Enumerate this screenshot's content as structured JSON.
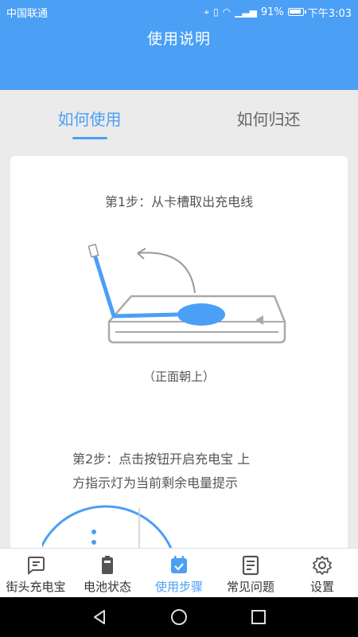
{
  "status": {
    "carrier": "中国联通",
    "battery": "91%",
    "time": "下午3:03"
  },
  "header": {
    "title": "使用说明"
  },
  "tabs": [
    {
      "label": "如何使用",
      "active": true
    },
    {
      "label": "如何归还",
      "active": false
    }
  ],
  "steps": {
    "step1": "第1步：从卡槽取出充电线",
    "step1_caption": "（正面朝上）",
    "step2_line1": "第2步：点击按钮开启充电宝 上",
    "step2_line2": "方指示灯为当前剩余电量提示"
  },
  "tabbar": [
    {
      "label": "街头充电宝",
      "icon": "message-icon",
      "active": false
    },
    {
      "label": "电池状态",
      "icon": "battery-icon",
      "active": false
    },
    {
      "label": "使用步骤",
      "icon": "calendar-check-icon",
      "active": true
    },
    {
      "label": "常见问题",
      "icon": "document-icon",
      "active": false
    },
    {
      "label": "设置",
      "icon": "gear-icon",
      "active": false
    }
  ],
  "colors": {
    "accent": "#4b9ff5",
    "text": "#333333",
    "muted": "#666666"
  }
}
